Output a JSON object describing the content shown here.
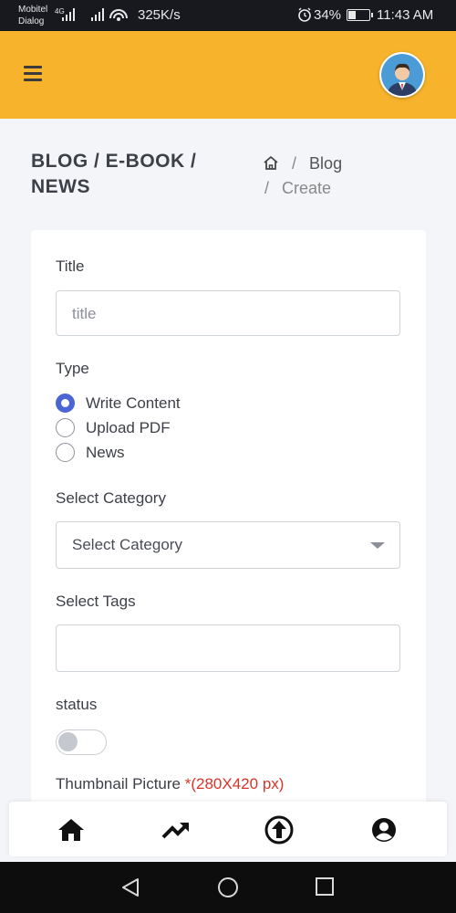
{
  "status_bar": {
    "carrier1": "Mobitel",
    "carrier2": "Dialog",
    "network": "4G",
    "speed": "325K/s",
    "battery": "34%",
    "time": "11:43 AM"
  },
  "header": {
    "menu_icon": "hamburger-icon",
    "avatar": "user-avatar"
  },
  "page": {
    "title": "BLOG / E-BOOK / NEWS",
    "breadcrumb": {
      "home_icon": "home-icon",
      "sep": "/",
      "item1": "Blog",
      "item2": "Create"
    }
  },
  "form": {
    "title_label": "Title",
    "title_placeholder": "title",
    "type_label": "Type",
    "type_options": [
      "Write Content",
      "Upload PDF",
      "News"
    ],
    "type_selected": "Write Content",
    "category_label": "Select Category",
    "category_value": "Select Category",
    "tags_label": "Select Tags",
    "tags_value": "",
    "status_label": "status",
    "status_on": false,
    "thumbnail_label": "Thumbnail Picture",
    "thumbnail_req": "*(280X420 px)"
  },
  "bottom_nav": [
    "home-icon",
    "trending-up-icon",
    "upload-icon",
    "account-icon"
  ],
  "colors": {
    "header_bg": "#f7b32b",
    "accent": "#4b66d4",
    "required": "#d8342a"
  }
}
